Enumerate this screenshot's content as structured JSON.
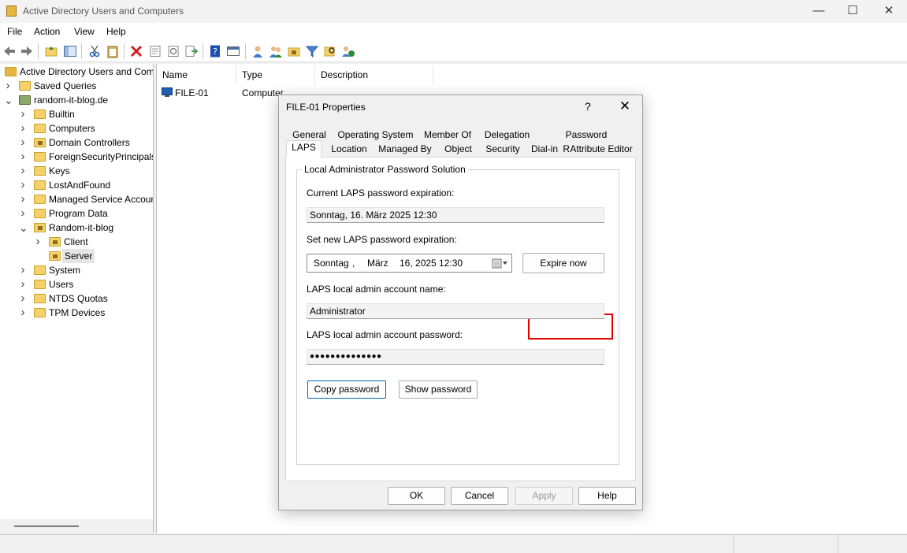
{
  "window": {
    "title": "Active Directory Users and Computers",
    "controls": [
      "—",
      "☐",
      "✕"
    ]
  },
  "menu": [
    "File",
    "Action",
    "View",
    "Help"
  ],
  "tree": {
    "root": "Active Directory Users and Com",
    "items": [
      {
        "label": "Saved Queries",
        "expander": ">"
      },
      {
        "label": "random-it-blog.de",
        "expander": "v"
      },
      {
        "label": "Builtin",
        "expander": ">"
      },
      {
        "label": "Computers",
        "expander": ">"
      },
      {
        "label": "Domain Controllers",
        "expander": ">"
      },
      {
        "label": "ForeignSecurityPrincipals",
        "expander": ">"
      },
      {
        "label": "Keys",
        "expander": ">"
      },
      {
        "label": "LostAndFound",
        "expander": ">"
      },
      {
        "label": "Managed Service Accour",
        "expander": ">"
      },
      {
        "label": "Program Data",
        "expander": ">"
      },
      {
        "label": "Random-it-blog",
        "expander": "v"
      },
      {
        "label": "Client",
        "expander": ">"
      },
      {
        "label": "Server",
        "expander": ""
      },
      {
        "label": "System",
        "expander": ">"
      },
      {
        "label": "Users",
        "expander": ">"
      },
      {
        "label": "NTDS Quotas",
        "expander": ">"
      },
      {
        "label": "TPM Devices",
        "expander": ">"
      }
    ]
  },
  "list": {
    "columns": [
      "Name",
      "Type",
      "Description"
    ],
    "rows": [
      {
        "name": "FILE-01",
        "type": "Computer",
        "description": ""
      }
    ]
  },
  "dialog": {
    "title": "FILE-01 Properties",
    "help": "?",
    "close": "✕",
    "tabs_row1": [
      "General",
      "Operating System",
      "Member Of",
      "Delegation",
      "Password Replication"
    ],
    "tabs_row2": [
      "LAPS",
      "Location",
      "Managed By",
      "Object",
      "Security",
      "Dial-in",
      "Attribute Editor"
    ],
    "group_title": "Local Administrator Password Solution",
    "current_exp_label": "Current LAPS password expiration:",
    "current_exp_value": "Sonntag, 16. März 2025 12:30",
    "set_exp_label": "Set new LAPS password expiration:",
    "date_day": "Sonntag",
    "date_sep": ",",
    "date_month": "März",
    "date_rest": "16, 2025 12:30",
    "expire_now": "Expire now",
    "account_label": "LAPS local admin account name:",
    "account_value": "Administrator",
    "password_label": "LAPS local admin account password:",
    "password_value": "●●●●●●●●●●●●●●",
    "copy_password": "Copy password",
    "show_password": "Show password",
    "ok": "OK",
    "cancel": "Cancel",
    "apply": "Apply",
    "help_btn": "Help"
  }
}
